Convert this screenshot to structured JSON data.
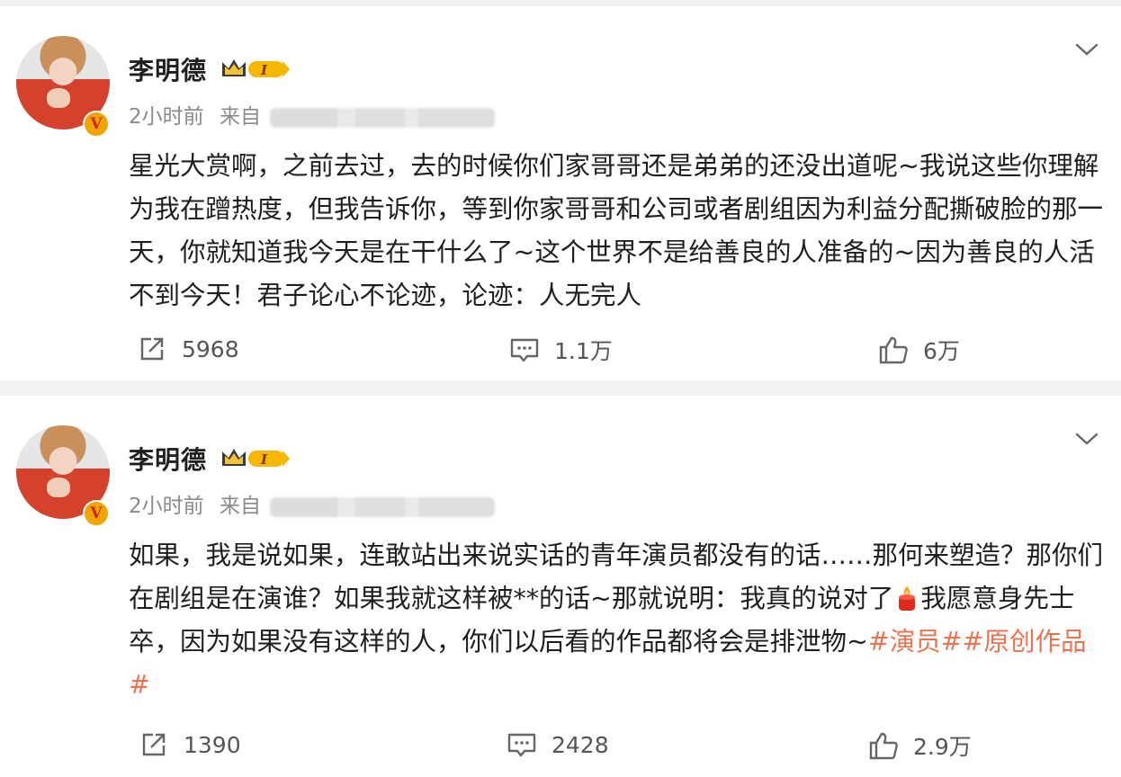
{
  "posts": [
    {
      "username": "李明德",
      "time": "2小时前",
      "source_prefix": "来自",
      "vip_level": "I",
      "content": "星光大赏啊，之前去过，去的时候你们家哥哥还是弟弟的还没出道呢~我说这些你理解为我在蹭热度，但我告诉你，等到你家哥哥和公司或者剧组因为利益分配撕破脸的那一天，你就知道我今天是在干什么了~这个世界不是给善良的人准备的~因为善良的人活不到今天！君子论心不论迹，论迹：人无完人",
      "repost_count": "5968",
      "comment_count": "1.1万",
      "like_count": "6万"
    },
    {
      "username": "李明德",
      "time": "2小时前",
      "source_prefix": "来自",
      "vip_level": "I",
      "content_before": "如果，我是说如果，连敢站出来说实话的青年演员都没有的话……那何来塑造？那你们在剧组是在演谁？如果我就这样被**的话~那就说明：我真的说对了",
      "content_after": "我愿意身先士卒，因为如果没有这样的人，你们以后看的作品都将会是排泄物~",
      "tags": "#演员##原创作品#",
      "emoji": "candle-emoji",
      "repost_count": "1390",
      "comment_count": "2428",
      "like_count": "2.9万"
    }
  ],
  "colors": {
    "tag": "#eb7350",
    "meta": "#8a8a8a",
    "separator": "#f2f2f2",
    "verified": "#f2a400"
  },
  "icons": [
    "chevron-down-icon",
    "repost-icon",
    "comment-icon",
    "like-icon",
    "crown-icon",
    "verified-icon"
  ]
}
